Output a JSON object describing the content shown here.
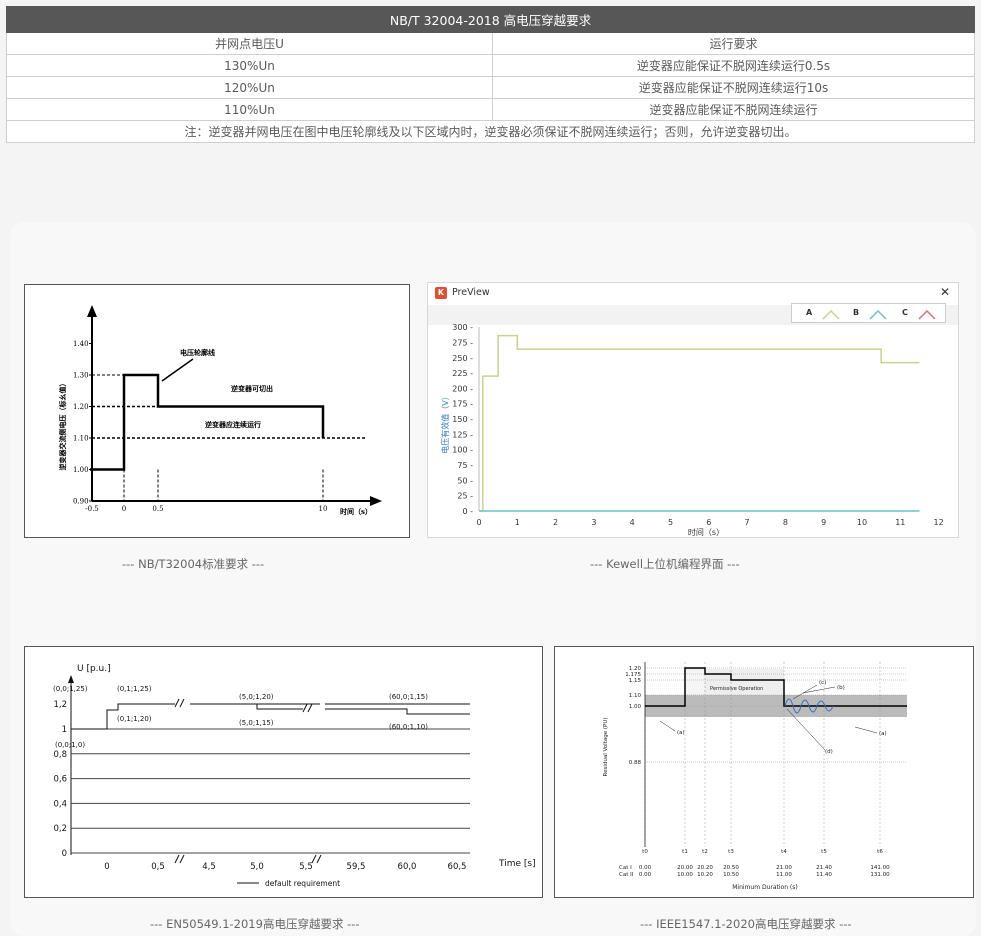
{
  "table": {
    "title": "NB/T 32004-2018 高电压穿越要求",
    "headers": [
      "并网点电压U",
      "运行要求"
    ],
    "rows": [
      [
        "130%Un",
        "逆变器应能保证不脱网连续运行0.5s"
      ],
      [
        "120%Un",
        "逆变器应能保证不脱网连续运行10s"
      ],
      [
        "110%Un",
        "逆变器应能保证不脱网连续运行"
      ]
    ],
    "note": "注：逆变器并网电压在图中电压轮廓线及以下区域内时，逆变器必须保证不脱网连续运行；否则，允许逆变器切出。"
  },
  "captions": {
    "nbt": "--- NB/T32004标准要求 ---",
    "kewell": "--- Kewell上位机编程界面 ---",
    "en": "--- EN50549.1-2019高电压穿越要求 ---",
    "ieee": "--- IEEE1547.1-2020高电压穿越要求 ---"
  },
  "nbt_chart": {
    "ylabel": "逆变器交流侧电压（标幺值）",
    "xlabel": "时间（s）",
    "x_ticks": [
      "-0.5",
      "0",
      "0.5",
      "10"
    ],
    "y_ticks": [
      "1.40",
      "1.30",
      "1.20",
      "1.10",
      "1.00",
      "0.90"
    ],
    "ann_contour": "电压轮廓线",
    "ann_trip": "逆变器可切出",
    "ann_run": "逆变器应连续运行",
    "chart_data": {
      "type": "line",
      "series": [
        {
          "x": [
            -0.5,
            0,
            0,
            0.5,
            0.5,
            10,
            10
          ],
          "y": [
            1.0,
            1.0,
            1.3,
            1.3,
            1.2,
            1.2,
            1.1
          ]
        }
      ],
      "ylim": [
        0.9,
        1.45
      ]
    }
  },
  "kewell": {
    "window_title": "PreView",
    "close_icon": "close-icon",
    "legend": [
      "A",
      "B",
      "C"
    ],
    "legend_colors": [
      "#c9d28a",
      "#5fc7c0",
      "#e86a78"
    ],
    "ylabel": "电压有效值（V）",
    "xlabel": "时间（s）",
    "y_ticks": [
      "0",
      "25",
      "50",
      "75",
      "100",
      "125",
      "150",
      "175",
      "200",
      "225",
      "250",
      "275",
      "300"
    ],
    "x_ticks": [
      "0",
      "1",
      "2",
      "3",
      "4",
      "5",
      "6",
      "7",
      "8",
      "9",
      "10",
      "11",
      "12"
    ],
    "chart_data": {
      "type": "line",
      "series": [
        {
          "name": "A",
          "x": [
            0,
            0.1,
            0.1,
            0.5,
            0.5,
            1,
            1,
            10.5,
            10.5,
            11.5
          ],
          "y": [
            0,
            0,
            220,
            220,
            286,
            286,
            264,
            264,
            242,
            242
          ]
        },
        {
          "name": "B",
          "x": [
            0,
            0.1,
            11.5
          ],
          "y": [
            0,
            0,
            0
          ]
        }
      ],
      "xlim": [
        0,
        12
      ],
      "ylim": [
        0,
        300
      ]
    }
  },
  "en_chart": {
    "ylabel": "U [p.u.]",
    "xlabel": "Time [s]",
    "y_ticks": [
      "1,2",
      "1",
      "0,8",
      "0,6",
      "0,4",
      "0,2",
      "0"
    ],
    "x_ticks": [
      "0",
      "0,5",
      "4,5",
      "5,0",
      "5,5",
      "59,5",
      "60,0",
      "60,5"
    ],
    "points": [
      "(0,0;1,25)",
      "(0,1;1,25)",
      "(0,1;1,20)",
      "(0,0;1,0)",
      "(5,0;1,20)",
      "(5,0;1,15)",
      "(60,0;1,15)",
      "(60,0;1,10)"
    ],
    "legend": "default requirement"
  },
  "ieee_chart": {
    "ylabel": "Residual Voltage (PU)",
    "xlabel": "Minimum Duration (s)",
    "y_ticks": [
      "1.20",
      "1.175",
      "1.15",
      "1.10",
      "1.00",
      "0.88"
    ],
    "t_labels": [
      "t0",
      "t1",
      "t2",
      "t3",
      "t4",
      "t5",
      "t6"
    ],
    "cat1_label": "Cat I",
    "cat2_label": "Cat II",
    "cat1": [
      "0.00",
      "20.00",
      "20.20",
      "20.50",
      "21.00",
      "21.40",
      "141.00"
    ],
    "cat2": [
      "0.00",
      "10.00",
      "10.20",
      "10.50",
      "11.00",
      "11.40",
      "131.00"
    ],
    "region_label": "Permissive Operation",
    "notes": [
      "(a)",
      "(b)",
      "(c)",
      "(a)",
      "(d)"
    ]
  }
}
